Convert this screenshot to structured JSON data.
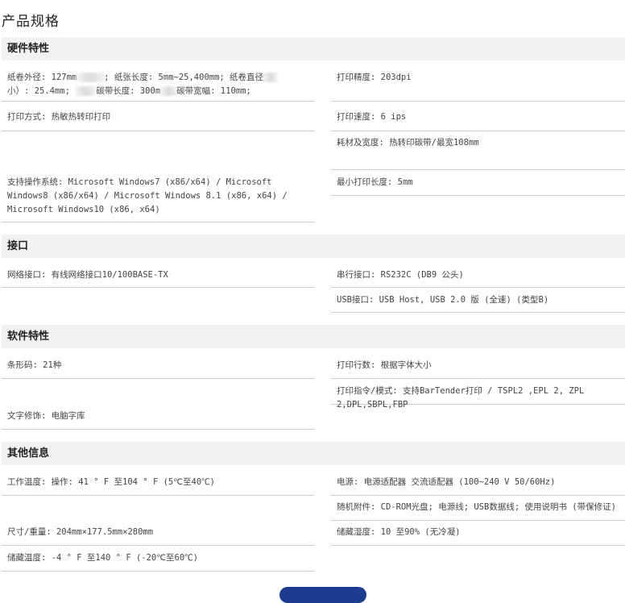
{
  "page": {
    "title": "产品规格"
  },
  "sections": {
    "hardware": {
      "title": "硬件特性",
      "roll_spec": {
        "part1": "纸卷外径: 127mm",
        "part2": "; 纸张长度: 5mm~25,400mm; 纸卷直径",
        "part3": "小）: 25.4mm; ",
        "part4": "碳带长度: 300m",
        "part5": "碳带宽幅: 110mm;"
      },
      "resolution": "打印精度: 203dpi",
      "print_method": "打印方式: 热敏热转印打印",
      "print_speed": "打印速度: 6 ips",
      "media_width": "耗材及宽度: 热转印碳带/最宽108mm",
      "os_support": "支持操作系统: Microsoft Windows7 (x86/x64) / Microsoft Windows8 (x86/x64) / Microsoft Windows 8.1 (x86, x64) / Microsoft Windows10 (x86, x64)",
      "min_print_length": "最小打印长度: 5mm"
    },
    "interface": {
      "title": "接口",
      "network": "网络接口: 有线网络接口10/100BASE-TX",
      "serial": "串行接口: RS232C (DB9 公头)",
      "usb": "USB接口: USB Host, USB 2.0 版 (全速) (类型B)"
    },
    "software": {
      "title": "软件特性",
      "barcode": "条形码: 21种",
      "print_lines": "打印行数: 根据字体大小",
      "commands": "打印指令/模式: 支持BarTender打印 / TSPL2 ,EPL 2, ZPL 2,DPL,SBPL,FBP",
      "text_effects": "文字修饰: 电脑字库"
    },
    "other": {
      "title": "其他信息",
      "operating_temp": "工作温度: 操作: 41 ° F 至104 ° F (5℃至40℃)",
      "power": "电源: 电源适配器 交流适配器 (100~240 V 50/60Hz)",
      "accessories": "随机附件: CD-ROM光盘; 电源线; USB数据线; 使用说明书 (带保修证)",
      "dimensions": "尺寸/重量: 204mm×177.5mm×280mm",
      "storage_humidity": "储藏湿度: 10 至90% (无冷凝)",
      "storage_temp": "储藏温度: -4 ° F 至140 ° F (-20℃至60℃)"
    }
  }
}
